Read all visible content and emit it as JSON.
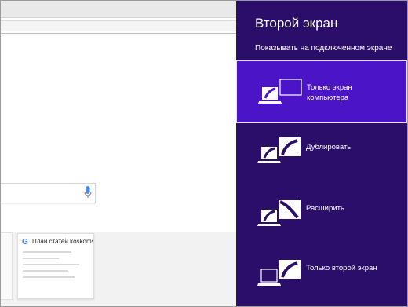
{
  "panel": {
    "title": "Второй экран",
    "subtitle": "Показывать на подключенном экране",
    "options": [
      {
        "label_line1": "Только экран",
        "label_line2": "компьютера",
        "selected": true
      },
      {
        "label_line1": "Дублировать",
        "selected": false
      },
      {
        "label_line1": "Расширить",
        "selected": false
      },
      {
        "label_line1": "Только второй экран",
        "selected": false
      }
    ],
    "colors": {
      "background": "#2a0e6a",
      "selected": "#4c14c7"
    }
  },
  "browser": {
    "thumbnail": {
      "title": "План статей koskoms",
      "icon": "G"
    }
  }
}
